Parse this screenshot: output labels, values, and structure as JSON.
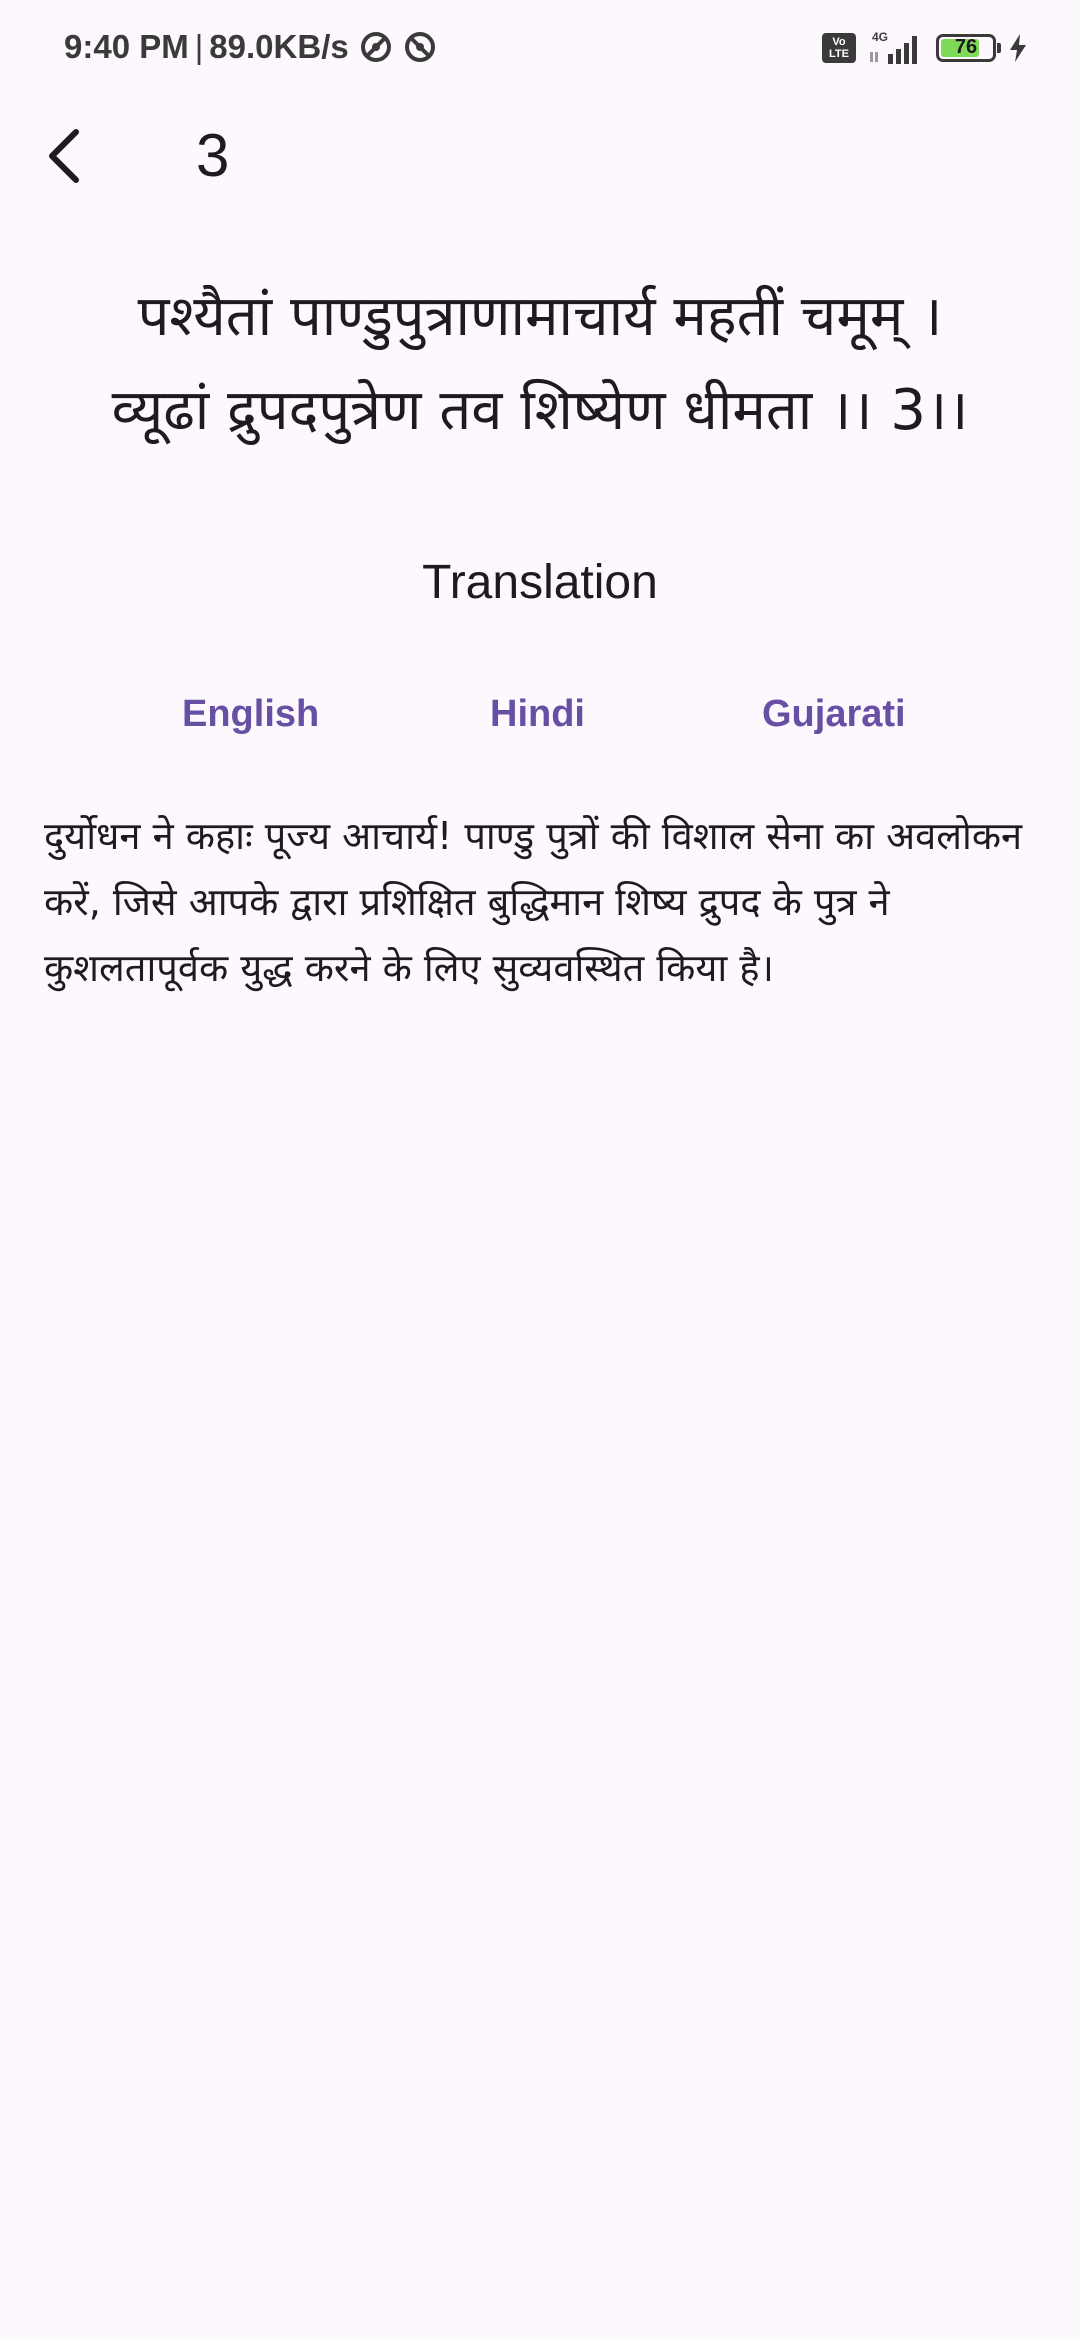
{
  "status_bar": {
    "time": "9:40 PM",
    "separator": "|",
    "speed": "89.0KB/s",
    "network_type": "4G",
    "volte": "Vo LTE",
    "battery_level": "76",
    "battery_fraction": 0.76
  },
  "app_bar": {
    "title": "3"
  },
  "verse": {
    "line1": "पश्यैतां पाण्डुपुत्राणामाचार्य महतीं चमूम् ।",
    "line2": "व्यूढां द्रुपदपुत्रेण तव शिष्येण धीमता ।। 3।।"
  },
  "translation": {
    "heading": "Translation",
    "tabs": [
      "English",
      "Hindi",
      "Gujarati"
    ],
    "text": "दुर्योधन ने कहाः पूज्य आचार्य! पाण्डु पुत्रों की विशाल सेना का अवलोकन करें, जिसे आपके द्वारा प्रशिक्षित बुद्धिमान शिष्य द्रुपद के पुत्र ने कुशलतापूर्वक युद्ध करने के लिए सुव्यवस्थित किया है।"
  },
  "colors": {
    "background": "#fdf8fd",
    "accent": "#6750a4",
    "text": "#1d1b20",
    "battery_fill": "#7ed957"
  }
}
